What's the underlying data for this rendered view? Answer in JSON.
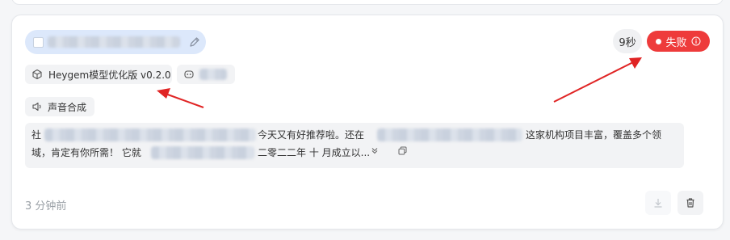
{
  "task": {
    "duration": "9秒",
    "status_label": "失败",
    "model_tag": "Heygem模型优化版 v0.2.0",
    "function_tag": "声音合成",
    "text_line1_part1": "社",
    "text_line1_part2": "今天又有好推荐啦。还在",
    "text_line1_part3": "这家机构项目丰富，覆盖多个领",
    "text_line2_part1": "域，肯定有你所需！ 它就",
    "text_line2_part2": "二零二二年 十 月成立以...",
    "timestamp": "3 分钟前"
  },
  "colors": {
    "status_failed": "#ee3b3b",
    "title_pill": "#dce8fb",
    "annotation_arrow": "#e02424"
  },
  "icons": {
    "edit": "pencil-icon",
    "model": "cube-icon",
    "avatar": "robot-face-icon",
    "audio": "speaker-icon",
    "status_info": "info-icon",
    "expand": "chevron-down-icon",
    "copy": "copy-icon",
    "download": "download-icon",
    "delete": "trash-icon"
  }
}
